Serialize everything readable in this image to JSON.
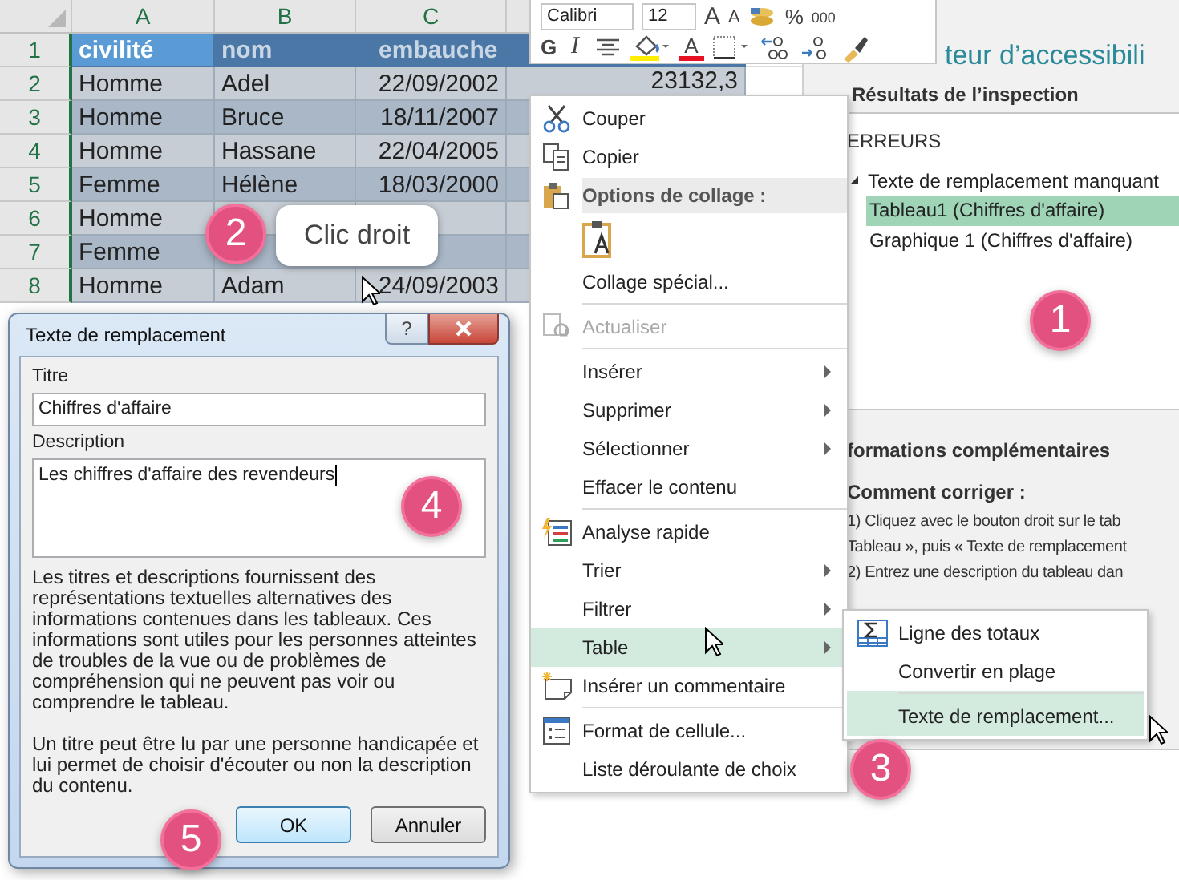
{
  "sheet": {
    "column_letters": [
      "A",
      "B",
      "C"
    ],
    "rows": [
      {
        "number": "1",
        "kind": "header",
        "cells": [
          "civilité",
          "nom",
          "embauche"
        ]
      },
      {
        "number": "2",
        "kind": "data",
        "cells": [
          "Homme",
          "Adel",
          "22/09/2002",
          "23132,3"
        ]
      },
      {
        "number": "3",
        "kind": "data",
        "cells": [
          "Homme",
          "Bruce",
          "18/11/2007"
        ]
      },
      {
        "number": "4",
        "kind": "data",
        "cells": [
          "Homme",
          "Hassane",
          "22/04/2005"
        ]
      },
      {
        "number": "5",
        "kind": "data",
        "cells": [
          "Femme",
          "Hélène",
          "18/03/2000"
        ]
      },
      {
        "number": "6",
        "kind": "data",
        "cells": [
          "Homme"
        ]
      },
      {
        "number": "7",
        "kind": "data",
        "cells": [
          "Femme"
        ]
      },
      {
        "number": "8",
        "kind": "data",
        "cells": [
          "Homme",
          "Adam",
          "24/09/2003"
        ]
      }
    ]
  },
  "callout": {
    "badge": "2",
    "text": "Clic droit"
  },
  "mini_toolbar": {
    "font": "Calibri",
    "size": "12",
    "grow": "A",
    "shrink": "A",
    "percent": "%",
    "thousands": "000",
    "bold": "G",
    "italic": "I",
    "font_color": "A"
  },
  "context_menu": {
    "items": [
      {
        "kind": "item",
        "label": "Couper",
        "submenu": false,
        "disabled": false,
        "selected": false,
        "divider_above": false
      },
      {
        "kind": "item",
        "label": "Copier",
        "submenu": false,
        "disabled": false,
        "selected": false,
        "divider_above": false
      },
      {
        "kind": "heading",
        "label": "Options de collage :"
      },
      {
        "kind": "paste-options"
      },
      {
        "kind": "item",
        "label": "Collage spécial...",
        "submenu": false,
        "disabled": false,
        "selected": false,
        "divider_above": false
      },
      {
        "kind": "item",
        "label": "Actualiser",
        "submenu": false,
        "disabled": true,
        "selected": false,
        "divider_above": true
      },
      {
        "kind": "item",
        "label": "Insérer",
        "submenu": true,
        "disabled": false,
        "selected": false,
        "divider_above": true
      },
      {
        "kind": "item",
        "label": "Supprimer",
        "submenu": true,
        "disabled": false,
        "selected": false,
        "divider_above": false
      },
      {
        "kind": "item",
        "label": "Sélectionner",
        "submenu": true,
        "disabled": false,
        "selected": false,
        "divider_above": false
      },
      {
        "kind": "item",
        "label": "Effacer le contenu",
        "submenu": false,
        "disabled": false,
        "selected": false,
        "divider_above": false
      },
      {
        "kind": "item",
        "label": "Analyse rapide",
        "submenu": false,
        "disabled": false,
        "selected": false,
        "divider_above": true
      },
      {
        "kind": "item",
        "label": "Trier",
        "submenu": true,
        "disabled": false,
        "selected": false,
        "divider_above": false
      },
      {
        "kind": "item",
        "label": "Filtrer",
        "submenu": true,
        "disabled": false,
        "selected": false,
        "divider_above": false
      },
      {
        "kind": "item",
        "label": "Table",
        "submenu": true,
        "disabled": false,
        "selected": true,
        "divider_above": false
      },
      {
        "kind": "item",
        "label": "Insérer un commentaire",
        "submenu": false,
        "disabled": false,
        "selected": false,
        "divider_above": false
      },
      {
        "kind": "item",
        "label": "Format de cellule...",
        "submenu": false,
        "disabled": false,
        "selected": false,
        "divider_above": true
      },
      {
        "kind": "item",
        "label": "Liste déroulante de choix",
        "submenu": false,
        "disabled": false,
        "selected": false,
        "divider_above": false
      }
    ]
  },
  "submenu": {
    "badge": "3",
    "items": [
      {
        "label": "Ligne des totaux",
        "selected": false,
        "divider_above": false
      },
      {
        "label": "Convertir en plage",
        "selected": false,
        "divider_above": false
      },
      {
        "label": "Texte de remplacement...",
        "selected": true,
        "divider_above": true
      }
    ]
  },
  "pane": {
    "title": "teur d’accessibili",
    "results_heading": "Résultats de l’inspection",
    "section": "ERREURS",
    "tree": [
      {
        "label": "Texte de remplacement manquant",
        "expanded": true,
        "children": [
          {
            "label": "Tableau1 (Chiffres d'affaire)",
            "selected": true
          },
          {
            "label": "Graphique 1 (Chiffres d'affaire)",
            "selected": false
          }
        ]
      }
    ],
    "badge": "1",
    "info_heading": "formations complémentaires",
    "fix_heading": "Comment corriger :",
    "fix_lines": [
      "1) Cliquez avec le bouton droit sur le tab",
      "Tableau », puis « Texte de remplacement",
      "2) Entrez une description du tableau dan"
    ]
  },
  "dialog": {
    "title": "Texte de remplacement",
    "help": "?",
    "title_label": "Titre",
    "title_value": "Chiffres d'affaire",
    "description_label": "Description",
    "description_value": "Les chiffres d'affaire des revendeurs",
    "badge_description": "4",
    "paragraphs": [
      "Les titres et descriptions fournissent des représentations textuelles alternatives des informations contenues dans les tableaux. Ces informations sont utiles pour les personnes atteintes de troubles de la vue ou de problèmes de compréhension qui ne peuvent pas voir ou comprendre le tableau.",
      "Un titre peut être lu par une personne handicapée et lui permet de choisir d'écouter ou non la description du contenu."
    ],
    "badge_buttons": "5",
    "buttons": [
      {
        "label": "OK",
        "focused": true
      },
      {
        "label": "Annuler",
        "focused": false
      }
    ]
  }
}
